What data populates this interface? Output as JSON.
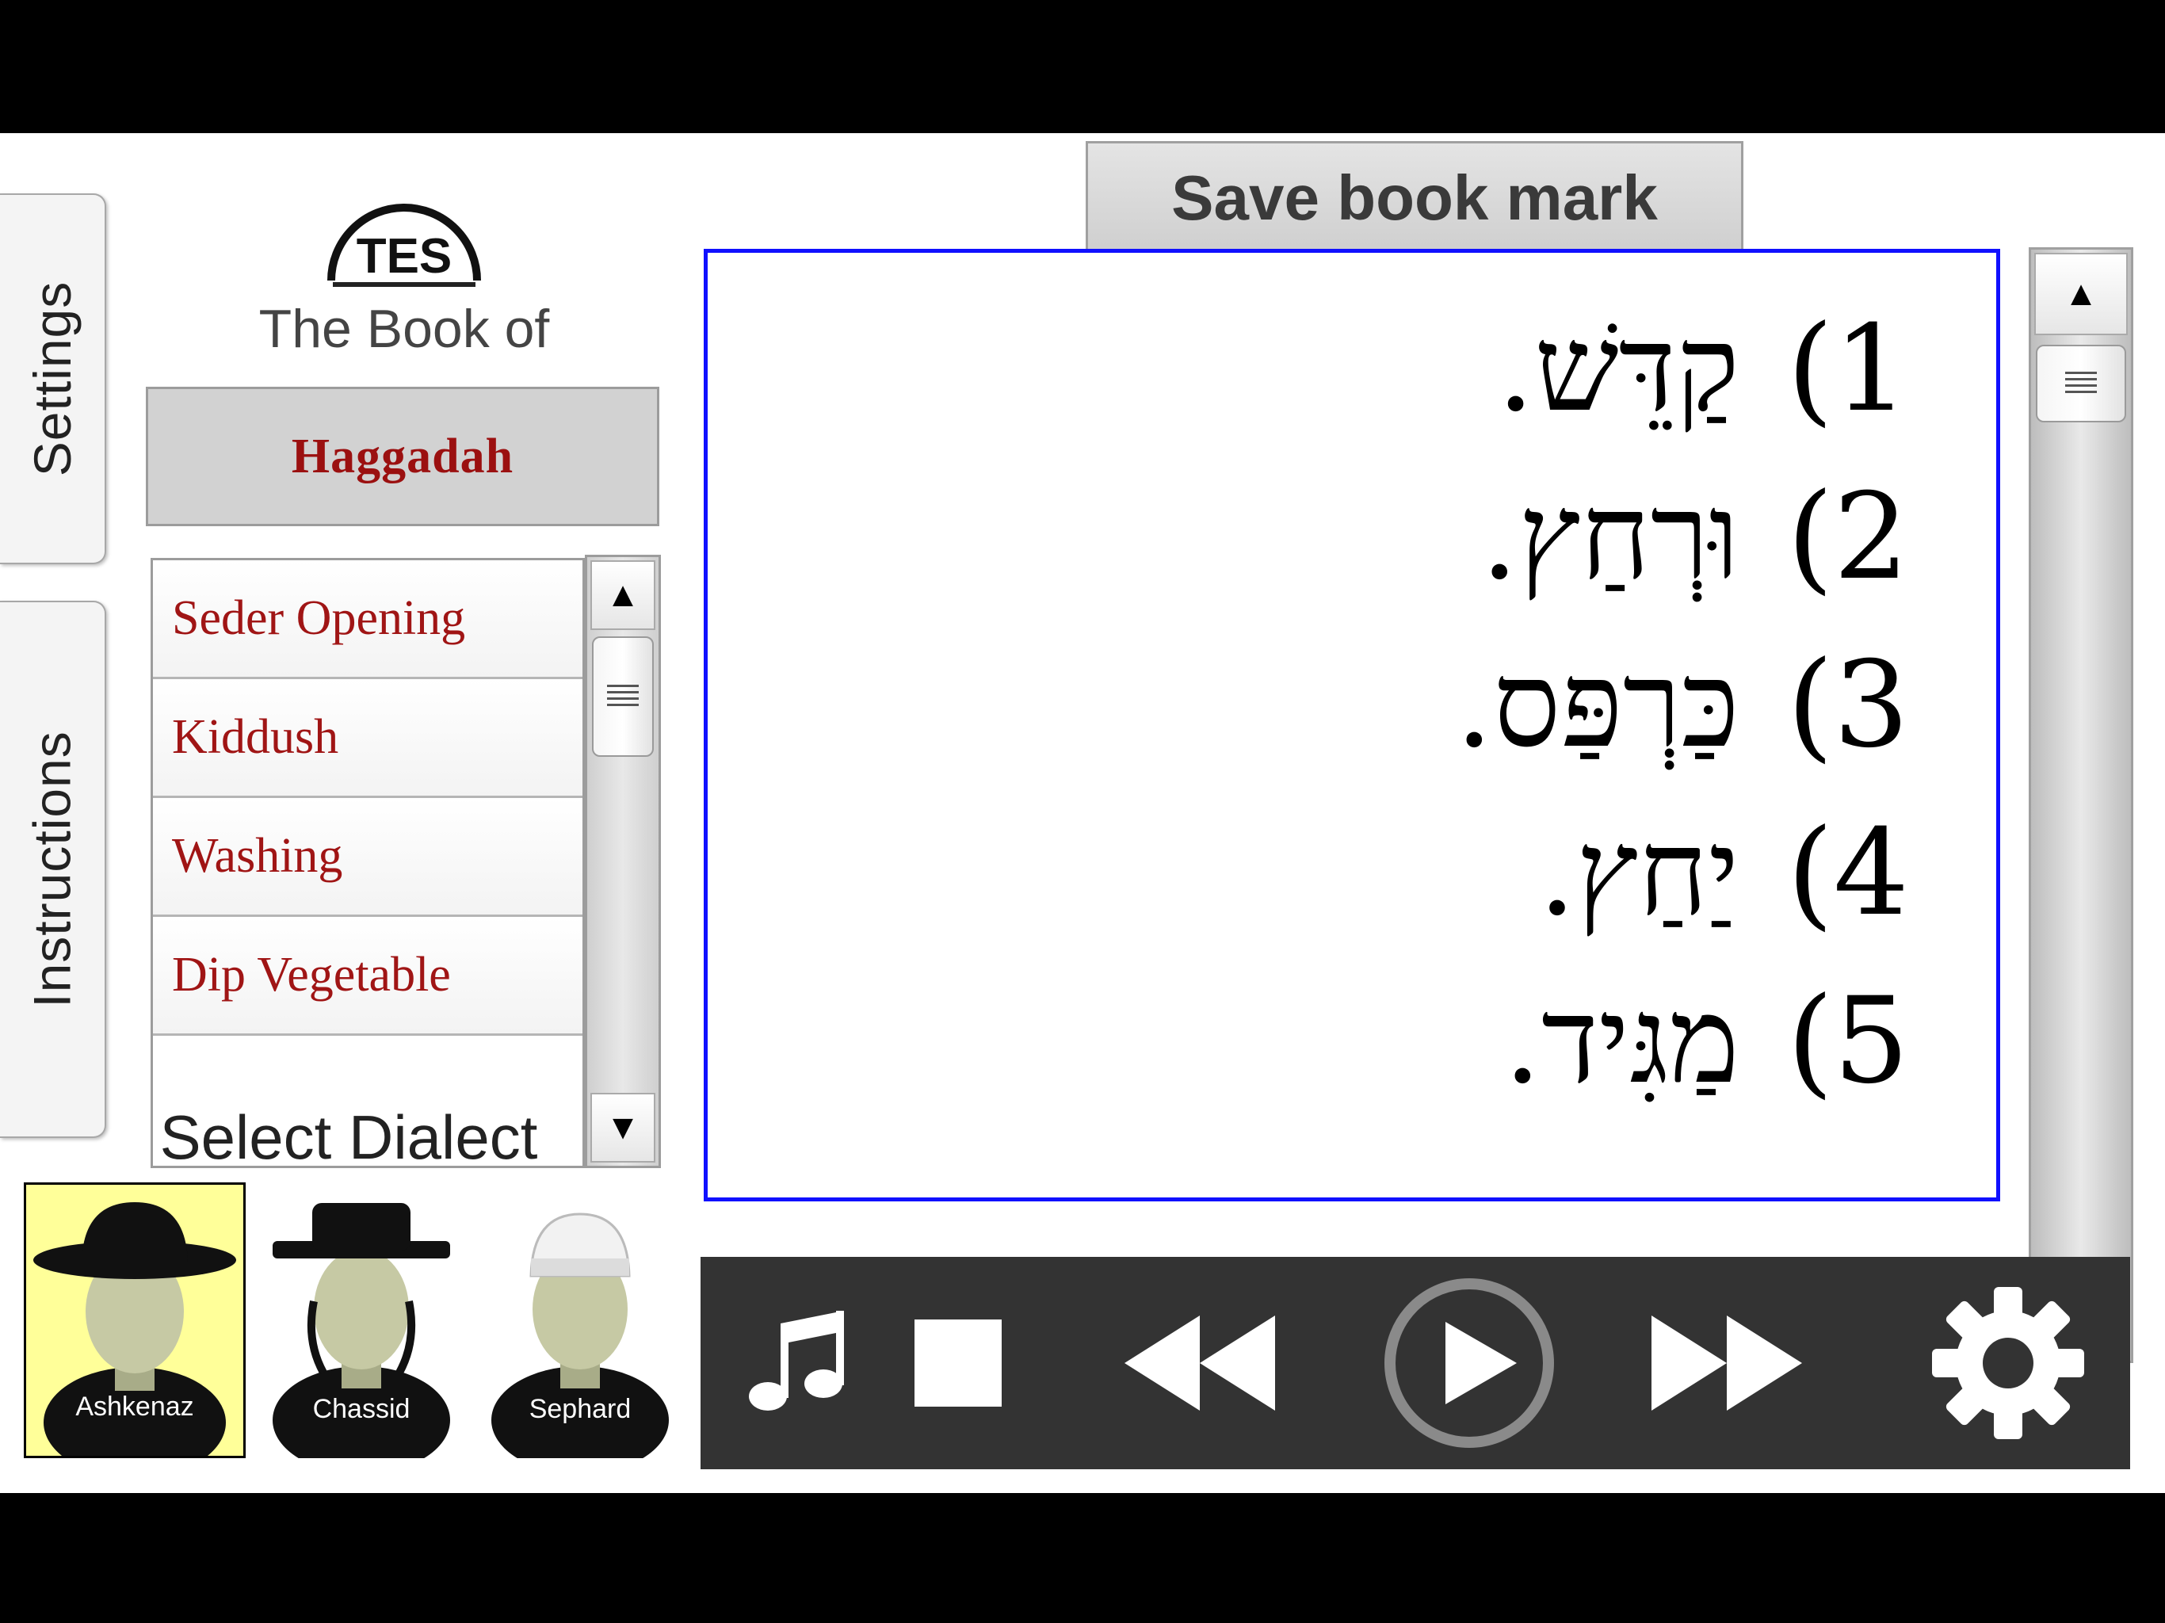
{
  "tabs": {
    "settings": "Settings",
    "instructions": "Instructions"
  },
  "logo": {
    "text": "TES"
  },
  "header": {
    "book_of": "The Book of",
    "title": "Haggadah"
  },
  "sections": [
    "Seder Opening",
    "Kiddush",
    "Washing",
    "Dip Vegetable"
  ],
  "dialect": {
    "label": "Select Dialect",
    "options": [
      "Ashkenaz",
      "Chassid",
      "Sephard"
    ],
    "selected": "Ashkenaz"
  },
  "toolbar": {
    "save_bookmark": "Save book mark"
  },
  "text_lines": [
    {
      "num": "(1",
      "hebrew": "קַדֵּשׁ."
    },
    {
      "num": "(2",
      "hebrew": "וּרְחַץ."
    },
    {
      "num": "(3",
      "hebrew": "כַּרְפַּס."
    },
    {
      "num": "(4",
      "hebrew": "יַחַץ."
    },
    {
      "num": "(5",
      "hebrew": "מַגִּיד."
    }
  ],
  "media_controls": [
    "music-icon",
    "stop-icon",
    "rewind-icon",
    "play-icon",
    "fast-forward-icon",
    "gear-icon"
  ],
  "colors": {
    "accent_border": "#1010ff",
    "title_red": "#9b1010",
    "selected_dialect": "#ffff99",
    "media_bar": "#333333"
  }
}
